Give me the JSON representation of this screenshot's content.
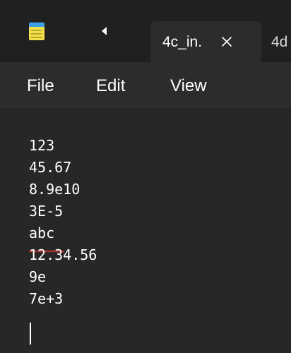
{
  "tabbar": {
    "app_icon": "notepad-icon",
    "scroll_left_icon": "caret-left-icon",
    "active_tab": {
      "label": "4c_in.",
      "close_icon": "close-icon"
    },
    "next_tab_label": "4d"
  },
  "menu": {
    "items": [
      "File",
      "Edit",
      "View"
    ]
  },
  "editor": {
    "lines": [
      "123",
      "45.67",
      "8.9e10",
      "3E-5",
      "abc",
      "12.34.56",
      "9e",
      "7e+3",
      ""
    ],
    "spellcheck_flagged_line": 4
  },
  "colors": {
    "background": "#272727",
    "tab_bar": "#202020",
    "active_tab": "#2c2c2c",
    "text": "#ffffff",
    "icon_blue": "#3aa0e8",
    "icon_yellow": "#f2e04a",
    "spellcheck_red": "#e53935"
  }
}
